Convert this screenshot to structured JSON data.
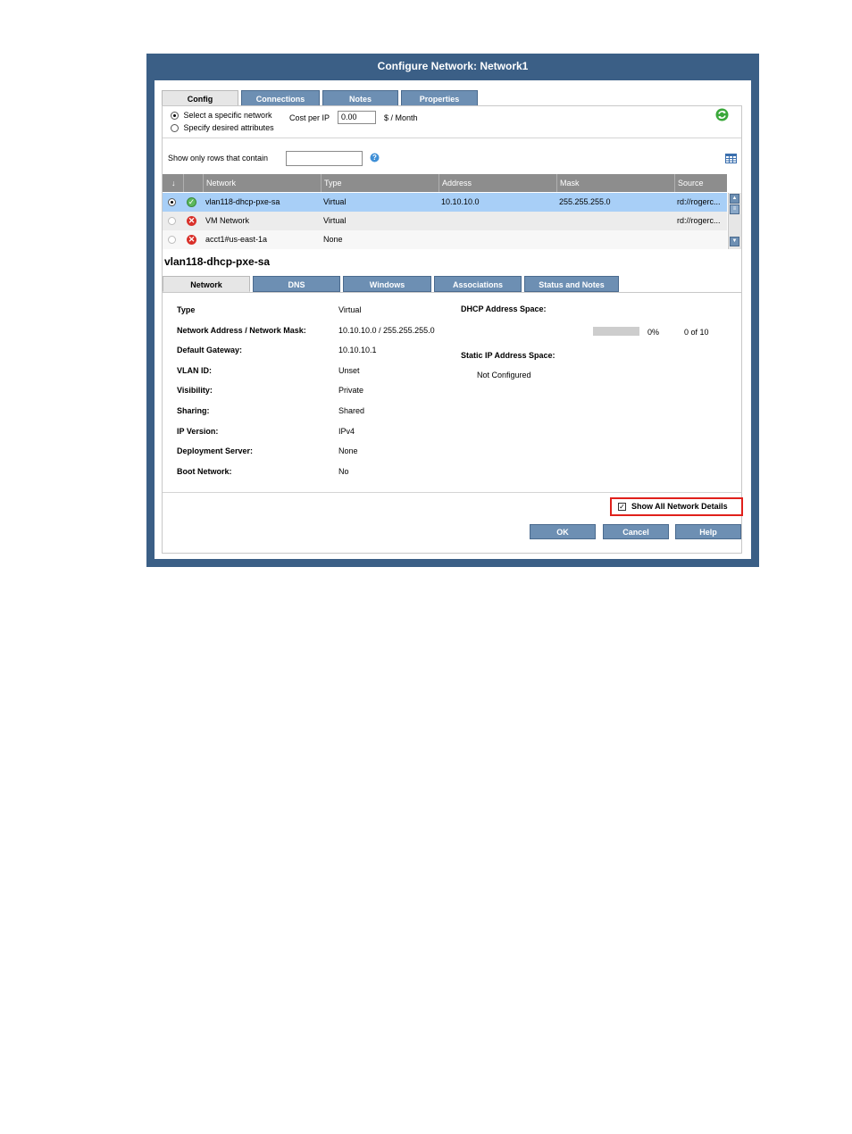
{
  "dialog": {
    "title": "Configure Network: Network1"
  },
  "tabs": [
    "Config",
    "Connections",
    "Notes",
    "Properties"
  ],
  "config": {
    "option_specific": "Select a specific network",
    "option_attributes": "Specify desired attributes",
    "cost_label": "Cost per IP",
    "cost_value": "0.00",
    "cost_unit": "$ / Month",
    "filter_label": "Show only rows that contain",
    "filter_value": ""
  },
  "grid": {
    "headers": [
      "↓",
      "",
      "Network",
      "Type",
      "Address",
      "Mask",
      "Source"
    ],
    "rows": [
      {
        "selected": true,
        "status": "ok",
        "network": "vlan118-dhcp-pxe-sa",
        "type": "Virtual",
        "address": "10.10.10.0",
        "mask": "255.255.255.0",
        "source": "rd://rogerc..."
      },
      {
        "selected": false,
        "status": "error",
        "network": "VM Network",
        "type": "Virtual",
        "address": "",
        "mask": "",
        "source": "rd://rogerc..."
      },
      {
        "selected": false,
        "status": "error",
        "network": "acct1#us-east-1a",
        "type": "None",
        "address": "",
        "mask": "",
        "source": ""
      }
    ]
  },
  "detail": {
    "title": "vlan118-dhcp-pxe-sa",
    "tabs": [
      "Network",
      "DNS",
      "Windows",
      "Associations",
      "Status and Notes"
    ],
    "fields": [
      {
        "label": "Type",
        "value": "Virtual"
      },
      {
        "label": "Network Address / Network Mask:",
        "value": "10.10.10.0 / 255.255.255.0"
      },
      {
        "label": "Default Gateway:",
        "value": "10.10.10.1"
      },
      {
        "label": "VLAN ID:",
        "value": "Unset"
      },
      {
        "label": "Visibility:",
        "value": "Private"
      },
      {
        "label": "Sharing:",
        "value": "Shared"
      },
      {
        "label": "IP Version:",
        "value": "IPv4"
      },
      {
        "label": "Deployment Server:",
        "value": "None"
      },
      {
        "label": "Boot Network:",
        "value": "No"
      }
    ],
    "dhcp_label": "DHCP Address Space:",
    "dhcp_percent": "0%",
    "dhcp_progress": 0,
    "dhcp_count": "0 of 10",
    "static_label": "Static IP Address Space:",
    "static_value": "Not Configured"
  },
  "show_all_label": "Show All Network Details",
  "show_all_checked": true,
  "buttons": {
    "ok": "OK",
    "cancel": "Cancel",
    "help": "Help"
  },
  "colors": {
    "dialog_frame": "#3b5f86",
    "tab_blue": "#6d8fb3",
    "row_selected": "#a8cff7",
    "highlight_border": "#e0201b"
  }
}
